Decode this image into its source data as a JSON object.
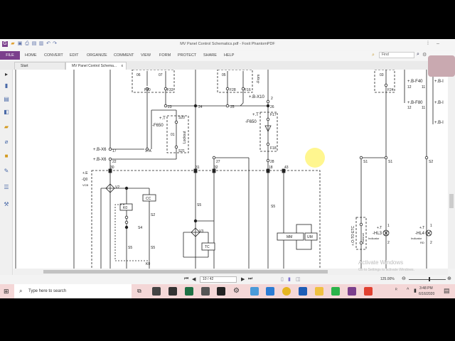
{
  "window": {
    "title": "MV Panel Control Schematics.pdf - Foxit PhantomPDF"
  },
  "menu": {
    "file": "FILE",
    "items": [
      "HOME",
      "CONVERT",
      "EDIT",
      "ORGANIZE",
      "COMMENT",
      "VIEW",
      "FORM",
      "PROTECT",
      "SHARE",
      "HELP"
    ],
    "search_placeholder": "Find"
  },
  "tabs": [
    {
      "label": "Start"
    },
    {
      "label": "MV Panel Control Schema...",
      "close": "x"
    }
  ],
  "status": {
    "page": "10 / 42",
    "zoom": "125.00%"
  },
  "schematic": {
    "labels": [
      "06",
      "07",
      "F30",
      "F33",
      "05",
      "F28",
      "F16",
      "+.B-X10",
      "2",
      "23",
      "24",
      "25",
      "26",
      "+.T",
      "-F650",
      "S20",
      "01",
      "Lockout",
      "S21",
      "+.T",
      "-F650",
      "F17",
      "F18",
      "+.B-X6",
      "17",
      "17A",
      "+.B-X6",
      "22",
      "27",
      "28",
      "30",
      "31",
      "32",
      "18",
      "43",
      "+.E",
      "-Q0",
      "VCB",
      "V2",
      "CC",
      "K0",
      "S2",
      "S4",
      "S5",
      "S5",
      "K0",
      "S5",
      "V3",
      "TC",
      "S5",
      "MM",
      "UM",
      "03",
      "F24",
      "+.B-F40",
      "12",
      "11",
      "+.B-F80",
      "12",
      "11",
      "S1",
      "S1",
      "S2",
      "+.O-TO ETC",
      "External",
      "+.T",
      "-HL3",
      "Indicator",
      "1",
      "2",
      "+.T",
      "-HL4",
      "Indicator",
      "RD",
      "1",
      "2",
      "+.B-I",
      "+.B-I",
      "+.B-I",
      "-From"
    ]
  },
  "watermark": {
    "line1": "Activate Windows",
    "line2": "Go to Settings to activate Windows."
  },
  "taskbar": {
    "search_placeholder": "Type here to search",
    "time": "3:48 PM",
    "date": "6/16/2020"
  }
}
